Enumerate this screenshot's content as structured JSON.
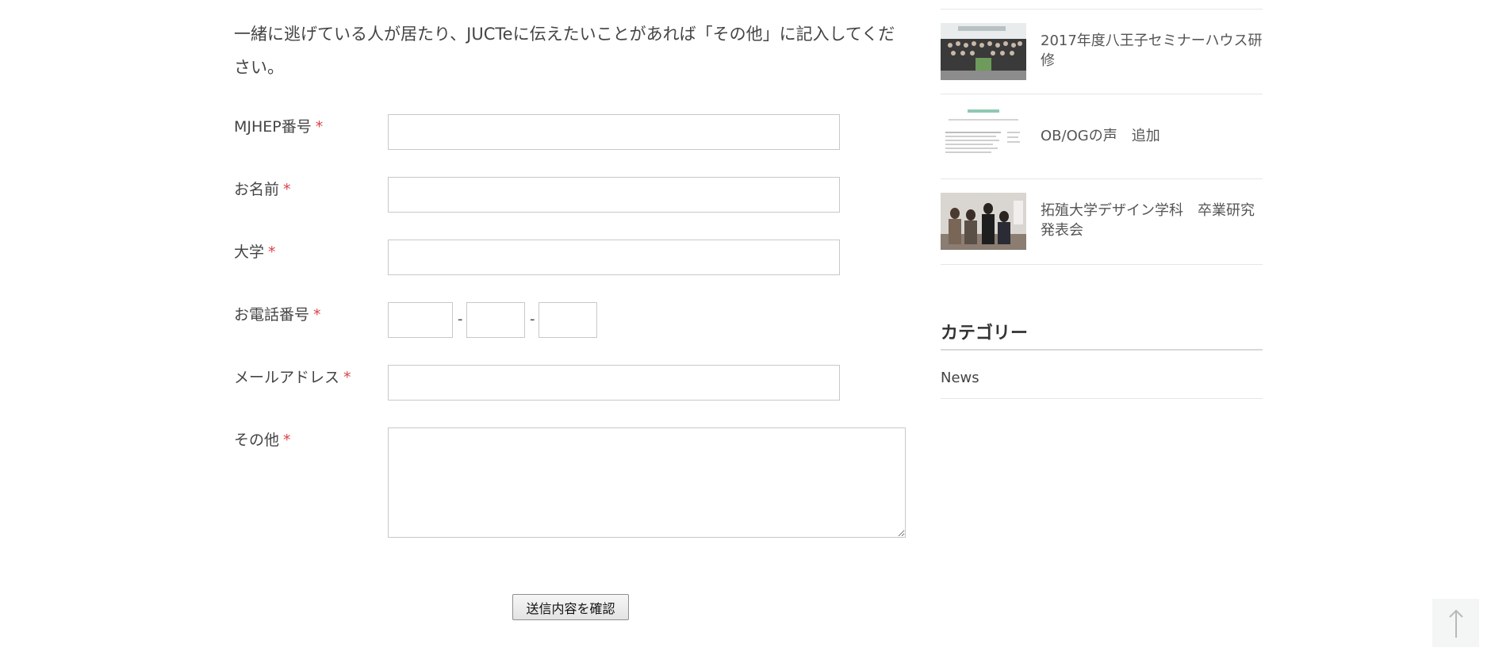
{
  "form": {
    "intro": "一緒に逃げている人が居たり、JUCTeに伝えたいことがあれば「その他」に記入してください。",
    "required_mark": "*",
    "fields": [
      {
        "label": "MJHEP番号",
        "value": ""
      },
      {
        "label": "お名前",
        "value": ""
      },
      {
        "label": "大学",
        "value": ""
      },
      {
        "label": "お電話番号",
        "value": ""
      },
      {
        "label": "メールアドレス",
        "value": ""
      },
      {
        "label": "その他",
        "value": ""
      }
    ],
    "phone_separator": "-",
    "submit_label": "送信内容を確認"
  },
  "sidebar": {
    "posts": [
      {
        "title": "2017年度八王子セミナーハウス研修"
      },
      {
        "title": "OB/OGの声　追加"
      },
      {
        "title": "拓殖大学デザイン学科　卒業研究発表会"
      }
    ],
    "categories_heading": "カテゴリー",
    "categories": [
      {
        "label": "News"
      }
    ]
  },
  "icons": {
    "back_to_top": "arrow-up-icon"
  },
  "colors": {
    "required": "#d8434a",
    "text": "#444444",
    "border": "#c8c8c8"
  }
}
